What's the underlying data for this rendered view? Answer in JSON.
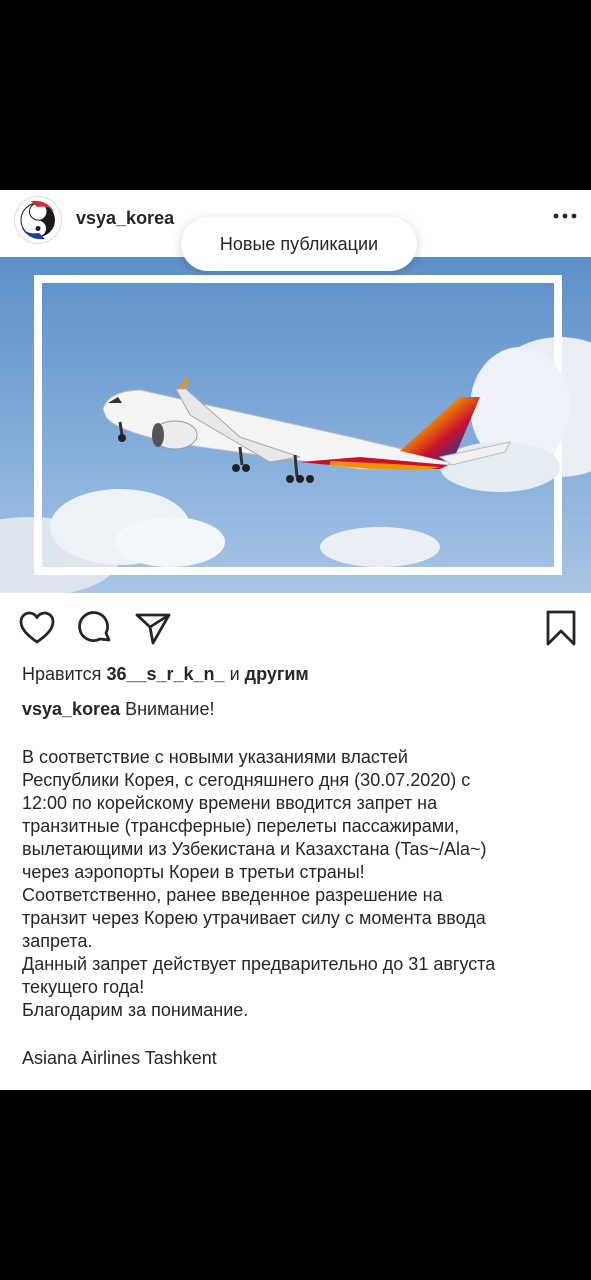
{
  "post": {
    "username": "vsya_korea",
    "new_posts_label": "Новые публикации",
    "likes": {
      "prefix": "Нравится",
      "user": "36__s_r_k_n_",
      "conjunction": "и",
      "others": "другим"
    },
    "caption": {
      "user": "vsya_korea",
      "headline": "Внимание!",
      "lines": [
        "В соответствие с новыми указаниями властей",
        "Республики Корея, с сегодняшнего дня (30.07.2020) с",
        "12:00 по корейскому времени вводится запрет на",
        "транзитные (трансферные) перелеты пассажирами,",
        "вылетающими из Узбекистана и Казахстана (Tas~/Ala~)",
        "через аэропорты Кореи в третьи страны!",
        "Соответственно, ранее введенное разрешение на",
        "транзит через Корею утрачивает силу с момента ввода",
        "запрета.",
        "Данный запрет действует предварительно до 31 августа",
        "текущего года!",
        "Благодарим за понимание."
      ],
      "signature": "Asiana Airlines Tashkent"
    }
  },
  "icons": {
    "like": "heart-icon",
    "comment": "comment-icon",
    "share": "share-icon",
    "save": "bookmark-icon",
    "more": "more-icon"
  },
  "colors": {
    "sky": "#6f9fd0",
    "asiana_red": "#c8102e",
    "asiana_orange": "#f39200",
    "asiana_yellow": "#f5c400",
    "asiana_blue": "#1a3fa0"
  }
}
